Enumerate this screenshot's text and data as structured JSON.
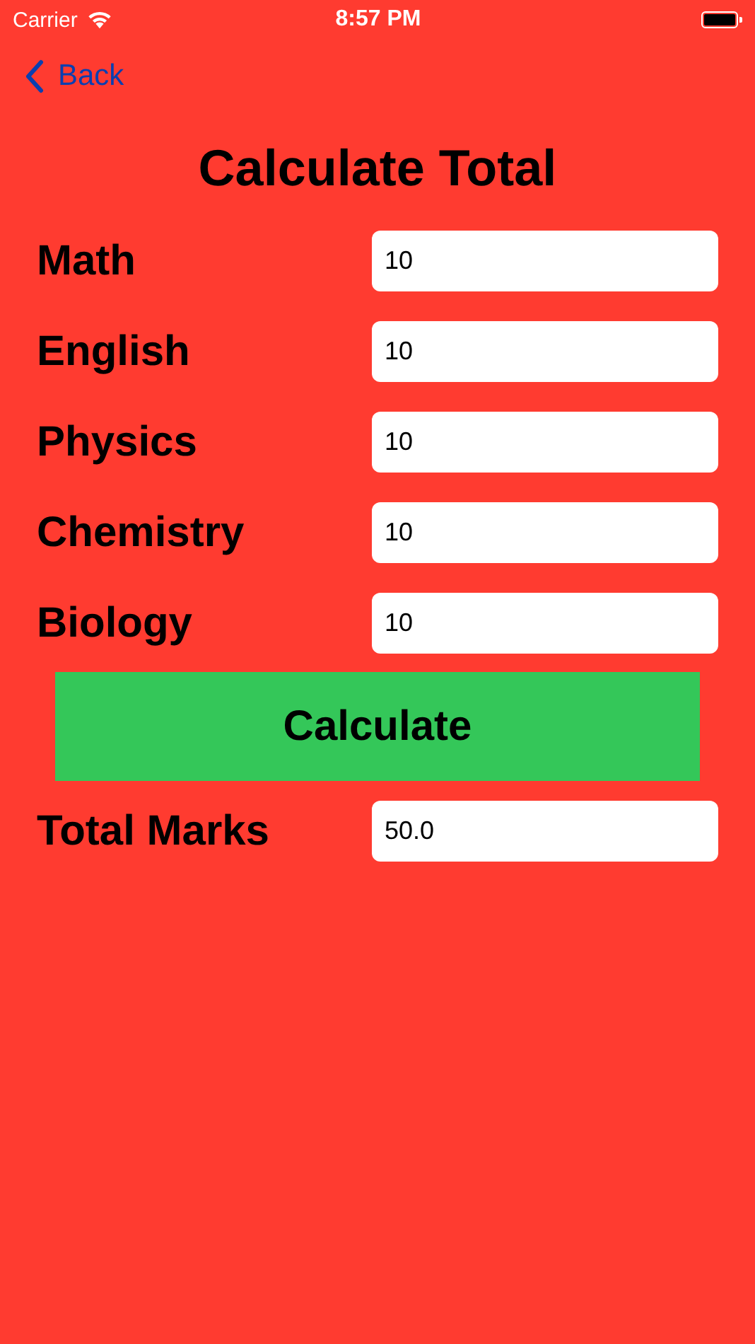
{
  "status_bar": {
    "carrier": "Carrier",
    "time": "8:57 PM"
  },
  "nav": {
    "back": "Back"
  },
  "title": "Calculate Total",
  "subjects": [
    {
      "label": "Math",
      "value": "10"
    },
    {
      "label": "English",
      "value": "10"
    },
    {
      "label": "Physics",
      "value": "10"
    },
    {
      "label": "Chemistry",
      "value": "10"
    },
    {
      "label": "Biology",
      "value": "10"
    }
  ],
  "calculate_button": "Calculate",
  "total": {
    "label": "Total Marks",
    "value": "50.0"
  }
}
